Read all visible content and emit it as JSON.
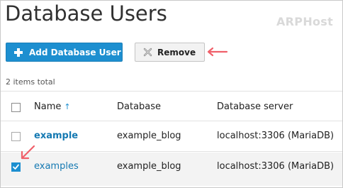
{
  "page": {
    "title": "Database Users",
    "watermark": "ARPHost"
  },
  "toolbar": {
    "add_label": "Add Database User",
    "remove_label": "Remove"
  },
  "table": {
    "total": "2 items total",
    "columns": [
      "Name",
      "Database",
      "Database server"
    ],
    "sort_indicator": "↑",
    "rows": [
      {
        "name": "example",
        "database": "example_blog",
        "server": "localhost:3306 (MariaDB)",
        "checked": false
      },
      {
        "name": "examples",
        "database": "example_blog",
        "server": "localhost:3306 (MariaDB)",
        "checked": true
      }
    ]
  },
  "colors": {
    "accent": "#1d8fd0",
    "link": "#1579b2",
    "annotation_arrow": "#f0606a"
  }
}
